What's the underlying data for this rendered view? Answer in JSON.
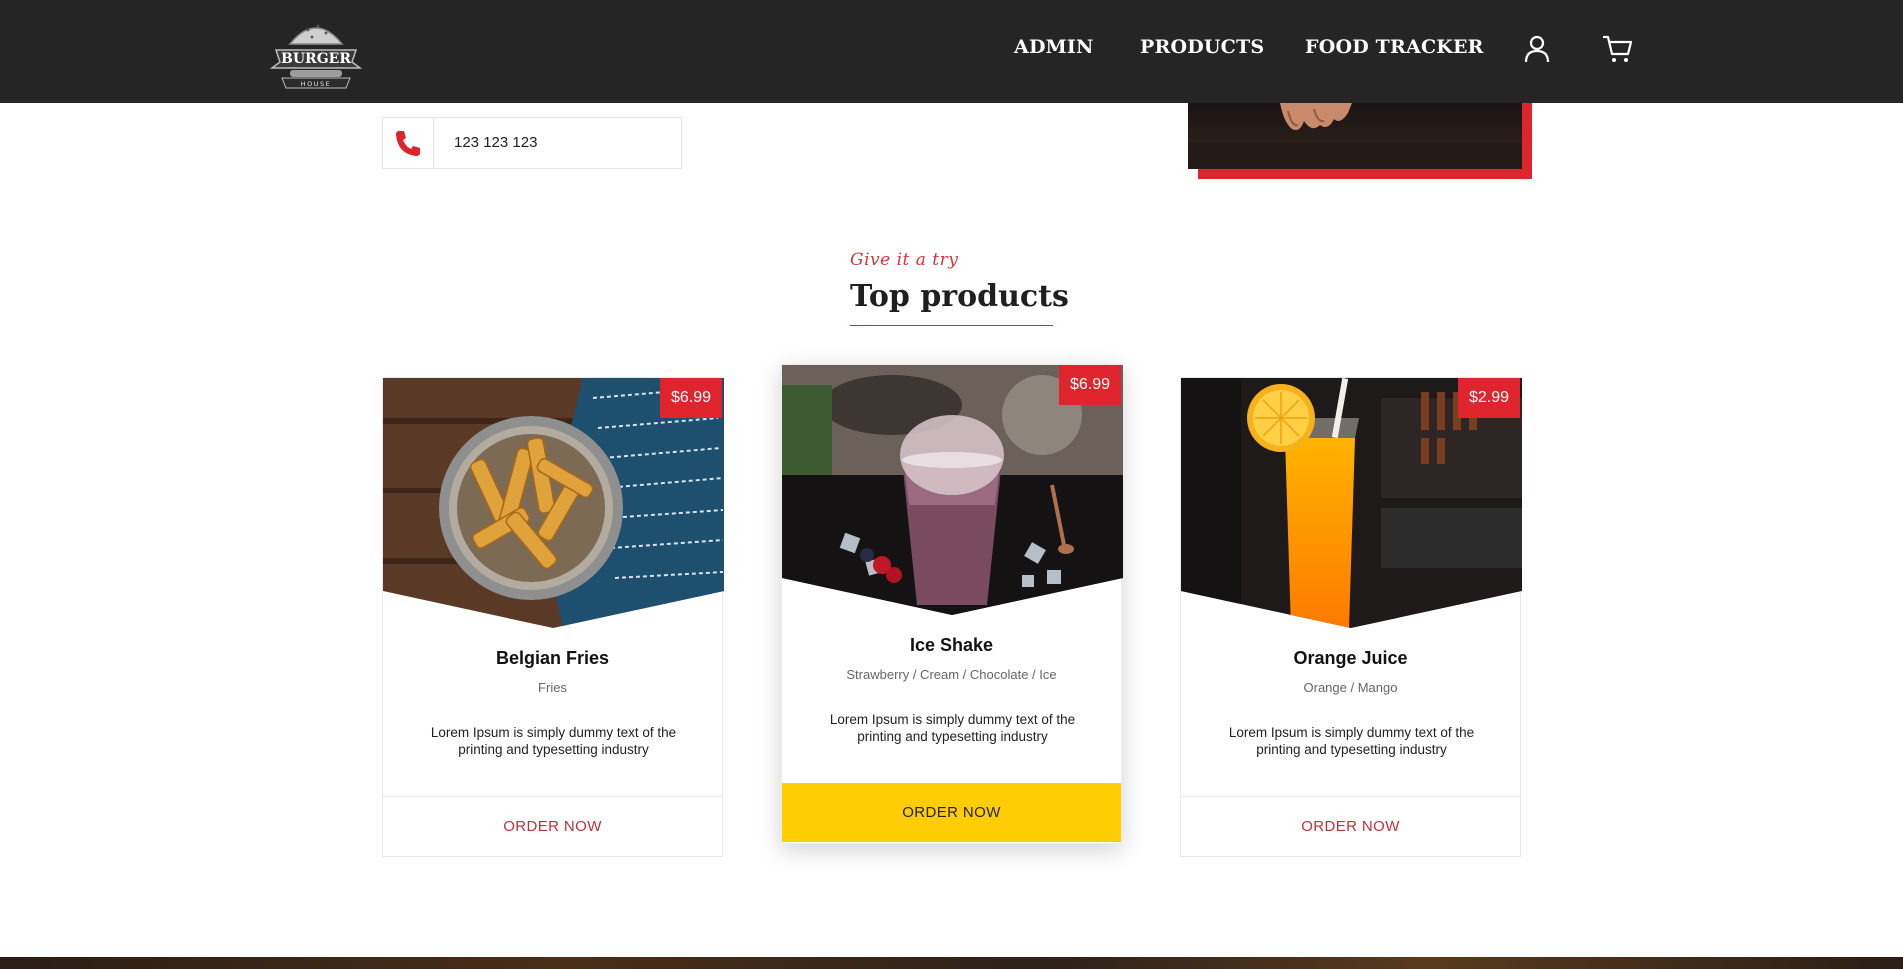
{
  "header": {
    "logo": {
      "line1": "BURGER",
      "line2": "HOUSE"
    },
    "nav": [
      {
        "label": "ADMIN"
      },
      {
        "label": "PRODUCTS"
      },
      {
        "label": "FOOD TRACKER"
      }
    ],
    "icons": [
      "user-icon",
      "cart-icon"
    ]
  },
  "contact": {
    "phone_icon": "phone-icon",
    "phone": "123 123 123"
  },
  "section": {
    "kicker": "Give it a try",
    "title": "Top products"
  },
  "products": [
    {
      "price": "$6.99",
      "name": "Belgian Fries",
      "subtitle": "Fries",
      "description": "Lorem Ipsum is simply dummy text of the printing and typesetting industry",
      "button": "ORDER NOW"
    },
    {
      "price": "$6.99",
      "name": "Ice Shake",
      "subtitle": "Strawberry / Cream / Chocolate / Ice",
      "description": "Lorem Ipsum is simply dummy text of the printing and typesetting industry",
      "button": "ORDER NOW",
      "featured": true
    },
    {
      "price": "$2.99",
      "name": "Orange Juice",
      "subtitle": "Orange / Mango",
      "description": "Lorem Ipsum is simply dummy text of the printing and typesetting industry",
      "button": "ORDER NOW"
    }
  ],
  "colors": {
    "header_bg": "#252525",
    "accent_red": "#e0242e",
    "button_yellow": "#ffcd04"
  }
}
